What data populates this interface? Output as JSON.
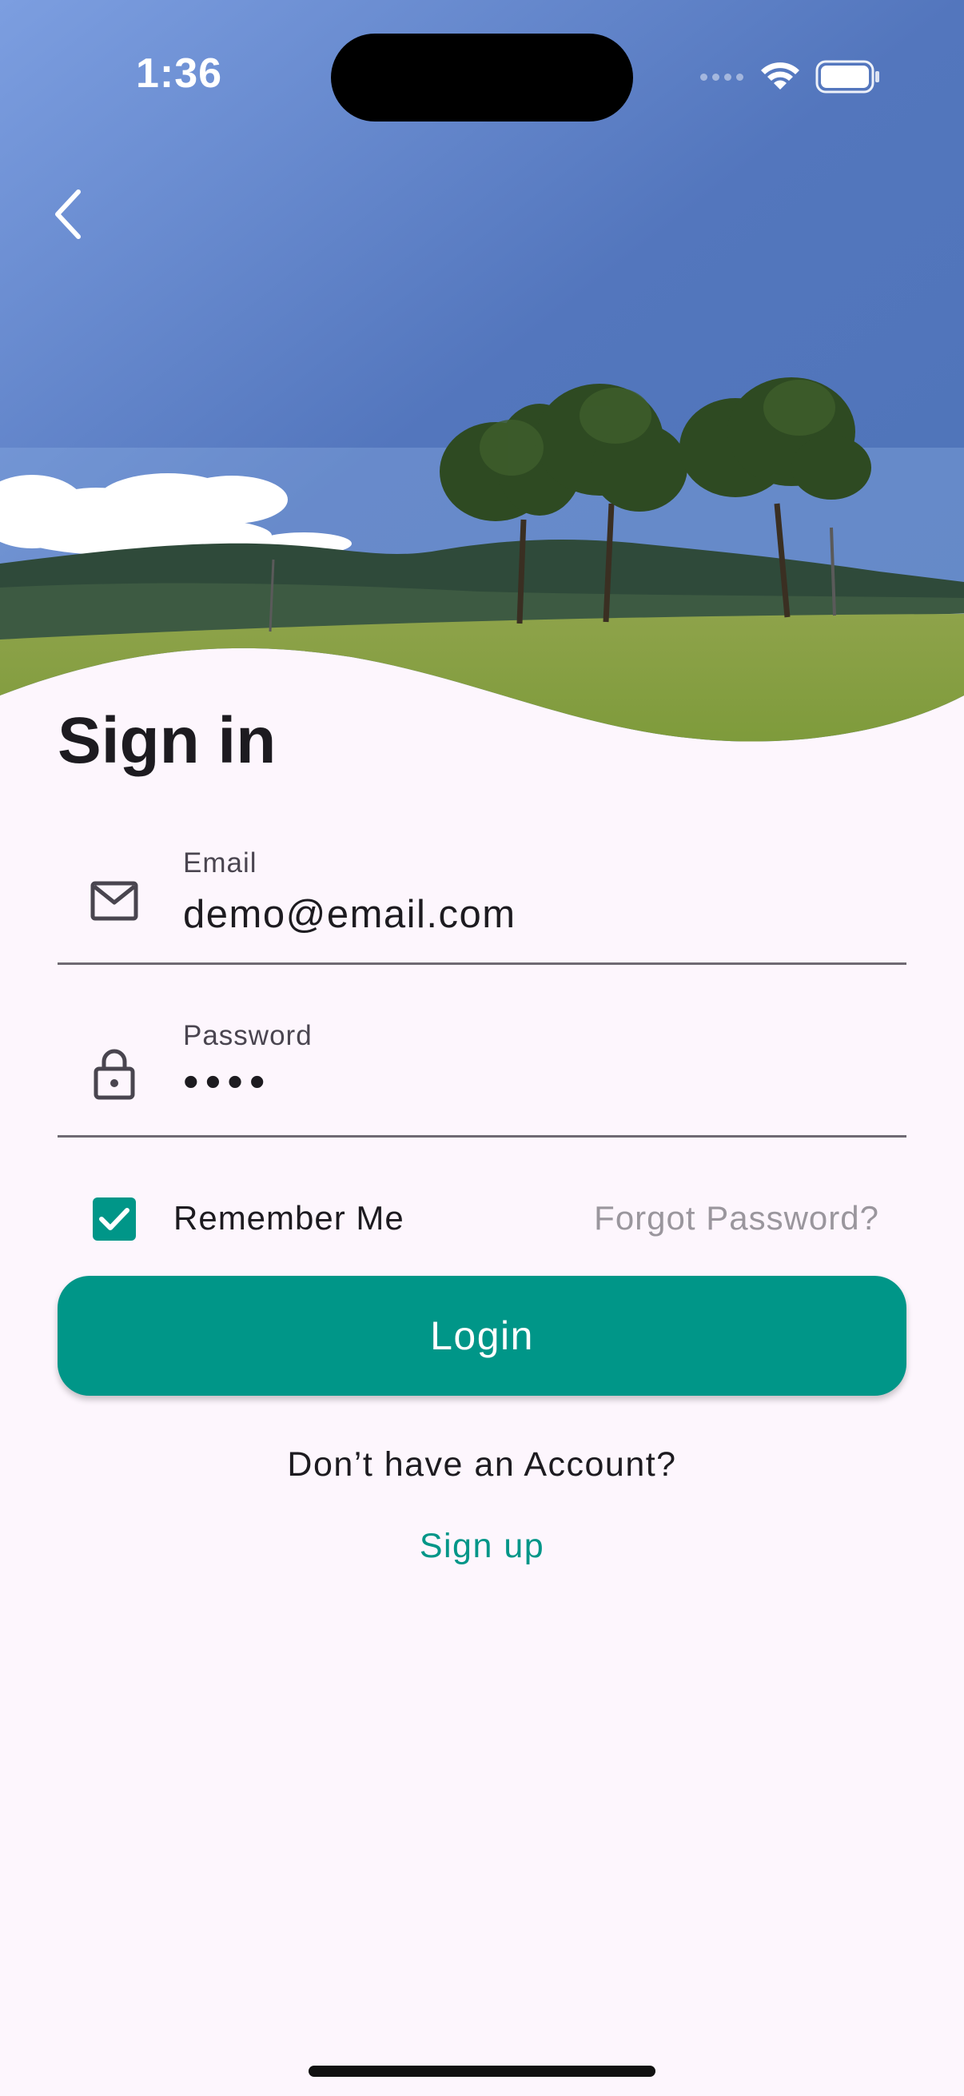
{
  "status_bar": {
    "time": "1:36"
  },
  "header": {
    "title": "Sign in"
  },
  "form": {
    "email": {
      "label": "Email",
      "value": "demo@email.com"
    },
    "password": {
      "label": "Password",
      "value": "••••"
    },
    "remember_label": "Remember Me",
    "remember_checked": true,
    "forgot_label": "Forgot Password?",
    "login_label": "Login"
  },
  "footer": {
    "prompt": "Don’t have an Account?",
    "signup_label": "Sign up"
  },
  "colors": {
    "accent": "#009688",
    "background": "#fdf6fd",
    "text": "#1d1b20"
  },
  "icons": {
    "back": "chevron-left-icon",
    "email": "mail-icon",
    "password": "lock-icon",
    "checkbox": "checkmark-icon",
    "wifi": "wifi-icon",
    "battery": "battery-icon"
  }
}
